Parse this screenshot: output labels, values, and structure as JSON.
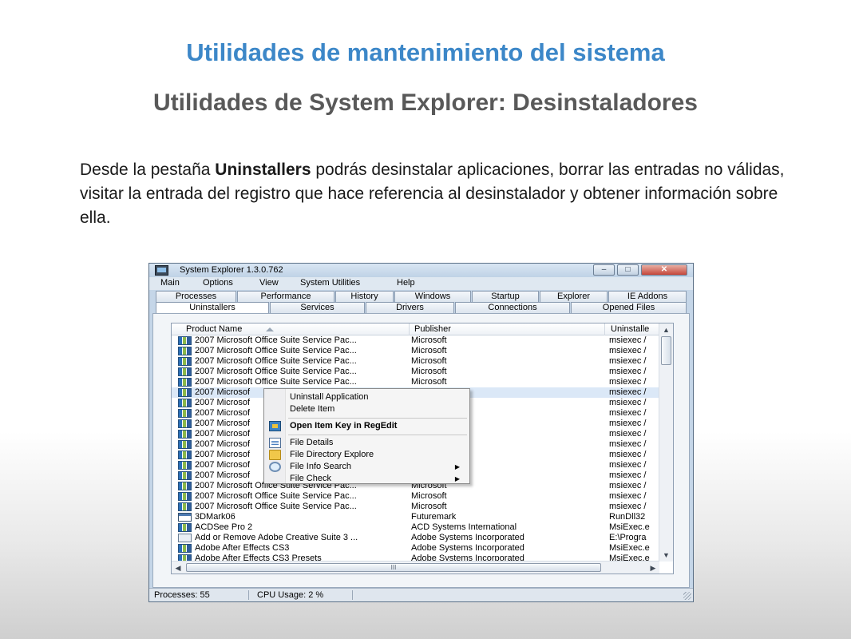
{
  "slide": {
    "title": "Utilidades de mantenimiento del sistema",
    "subtitle": "Utilidades de System Explorer: Desinstaladores",
    "body_before": "Desde la pestaña ",
    "body_bold": "Uninstallers",
    "body_after": " podrás desinstalar aplicaciones, borrar las entradas no válidas, visitar la entrada del registro que hace referencia al desinstalador y obtener información sobre ella."
  },
  "window": {
    "title": "System Explorer 1.3.0.762",
    "controls": {
      "minimize": "–",
      "maximize": "□",
      "close": "✕"
    },
    "menu": [
      "Main",
      "Options",
      "View",
      "System Utilities",
      "Help"
    ],
    "tabs_row1": [
      "Processes",
      "Performance",
      "History",
      "Windows",
      "Startup",
      "Explorer",
      "IE Addons"
    ],
    "tabs_row2": [
      "Uninstallers",
      "Services",
      "Drivers",
      "Connections",
      "Opened Files"
    ],
    "active_tab": "Uninstallers",
    "columns": [
      "Product Name",
      "Publisher",
      "Uninstalle"
    ],
    "rows": [
      {
        "name": "2007 Microsoft Office Suite Service Pac...",
        "publisher": "Microsoft",
        "uninstall": "msiexec /",
        "icon": "setup-icon"
      },
      {
        "name": "2007 Microsoft Office Suite Service Pac...",
        "publisher": "Microsoft",
        "uninstall": "msiexec /",
        "icon": "setup-icon"
      },
      {
        "name": "2007 Microsoft Office Suite Service Pac...",
        "publisher": "Microsoft",
        "uninstall": "msiexec /",
        "icon": "setup-icon"
      },
      {
        "name": "2007 Microsoft Office Suite Service Pac...",
        "publisher": "Microsoft",
        "uninstall": "msiexec /",
        "icon": "setup-icon"
      },
      {
        "name": "2007 Microsoft Office Suite Service Pac...",
        "publisher": "Microsoft",
        "uninstall": "msiexec /",
        "icon": "setup-icon"
      },
      {
        "name": "2007 Microsof",
        "publisher": "",
        "uninstall": "msiexec /",
        "icon": "setup-icon",
        "selected": true
      },
      {
        "name": "2007 Microsof",
        "publisher": "",
        "uninstall": "msiexec /",
        "icon": "setup-icon"
      },
      {
        "name": "2007 Microsof",
        "publisher": "",
        "uninstall": "msiexec /",
        "icon": "setup-icon"
      },
      {
        "name": "2007 Microsof",
        "publisher": "",
        "uninstall": "msiexec /",
        "icon": "setup-icon"
      },
      {
        "name": "2007 Microsof",
        "publisher": "",
        "uninstall": "msiexec /",
        "icon": "setup-icon"
      },
      {
        "name": "2007 Microsof",
        "publisher": "",
        "uninstall": "msiexec /",
        "icon": "setup-icon"
      },
      {
        "name": "2007 Microsof",
        "publisher": "",
        "uninstall": "msiexec /",
        "icon": "setup-icon"
      },
      {
        "name": "2007 Microsof",
        "publisher": "",
        "uninstall": "msiexec /",
        "icon": "setup-icon"
      },
      {
        "name": "2007 Microsof",
        "publisher": "",
        "uninstall": "msiexec /",
        "icon": "setup-icon"
      },
      {
        "name": "2007 Microsoft Office Suite Service Pac...",
        "publisher": "Microsoft",
        "uninstall": "msiexec /",
        "icon": "setup-icon"
      },
      {
        "name": "2007 Microsoft Office Suite Service Pac...",
        "publisher": "Microsoft",
        "uninstall": "msiexec /",
        "icon": "setup-icon"
      },
      {
        "name": "2007 Microsoft Office Suite Service Pac...",
        "publisher": "Microsoft",
        "uninstall": "msiexec /",
        "icon": "setup-icon"
      },
      {
        "name": "3DMark06",
        "publisher": "Futuremark",
        "uninstall": "RunDll32",
        "icon": "window-icon"
      },
      {
        "name": "ACDSee Pro 2",
        "publisher": "ACD Systems International",
        "uninstall": "MsiExec.e",
        "icon": "setup-icon"
      },
      {
        "name": "Add or Remove Adobe Creative Suite 3 ...",
        "publisher": "Adobe Systems Incorporated",
        "uninstall": "E:\\Progra",
        "icon": "acd-icon"
      },
      {
        "name": "Adobe After Effects CS3",
        "publisher": "Adobe Systems Incorporated",
        "uninstall": "MsiExec.e",
        "icon": "setup-icon"
      },
      {
        "name": "Adobe After Effects CS3 Presets",
        "publisher": "Adobe Systems Incorporated",
        "uninstall": "MsiExec.e",
        "icon": "setup-icon"
      }
    ],
    "context_menu": [
      {
        "label": "Uninstall Application",
        "bold": false,
        "icon": null,
        "submenu": false
      },
      {
        "label": "Delete Item",
        "bold": false,
        "icon": null,
        "submenu": false
      },
      {
        "separator": true
      },
      {
        "label": "Open Item Key in RegEdit",
        "bold": true,
        "icon": "regedit-icon",
        "submenu": false
      },
      {
        "separator": true
      },
      {
        "label": "File Details",
        "bold": false,
        "icon": "file-details-icon",
        "submenu": false
      },
      {
        "label": "File Directory Explore",
        "bold": false,
        "icon": "folder-icon",
        "submenu": false
      },
      {
        "label": "File Info Search",
        "bold": false,
        "icon": "search-icon",
        "submenu": true
      },
      {
        "label": "File Check",
        "bold": false,
        "icon": null,
        "submenu": true
      }
    ],
    "status": {
      "processes": "Processes: 55",
      "cpu": "CPU Usage: 2 %"
    },
    "scroll_glyphs": {
      "up": "▲",
      "down": "▼",
      "left": "◀",
      "right": "▶",
      "grip": "III",
      "submenu": "▶"
    }
  }
}
